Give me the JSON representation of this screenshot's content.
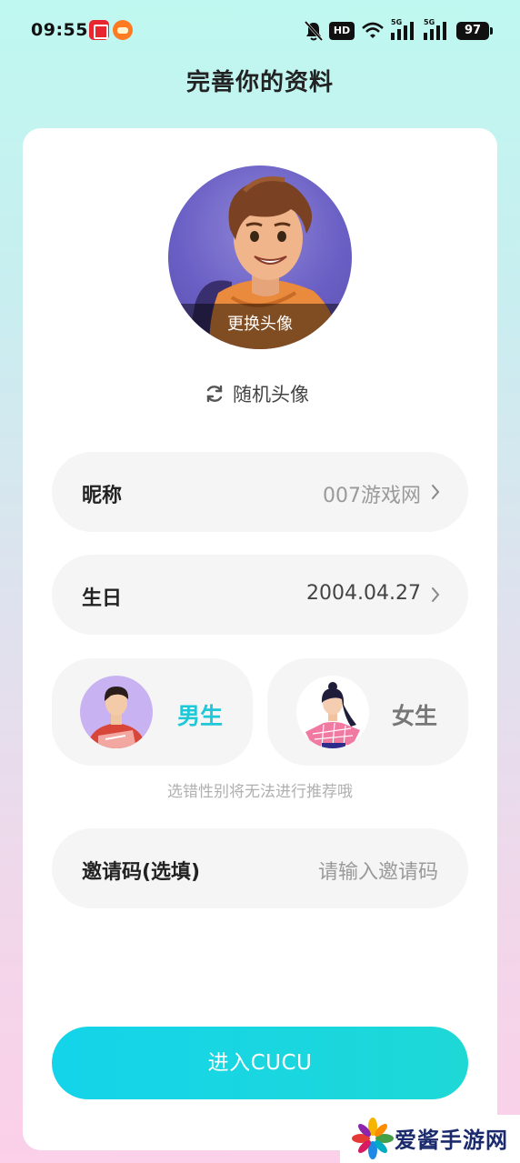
{
  "status_bar": {
    "time": "09:55",
    "network_badge": "HD",
    "signal1_label": "5G",
    "signal2_label": "5G",
    "battery": "97",
    "icons": [
      "taobao-app-icon",
      "food-app-icon",
      "mute-bell-icon",
      "hd-icon",
      "wifi-icon",
      "signal-icon",
      "signal-icon",
      "battery-icon"
    ]
  },
  "header": {
    "title": "完善你的资料"
  },
  "avatar": {
    "change_label": "更换头像",
    "random_label": "随机头像"
  },
  "form": {
    "nickname": {
      "label": "昵称",
      "value": "007游戏网"
    },
    "birthday": {
      "label": "生日",
      "value": "2004.04.27"
    },
    "gender": {
      "male_label": "男生",
      "female_label": "女生",
      "selected": "male",
      "hint": "选错性别将无法进行推荐哦"
    },
    "invite": {
      "label": "邀请码(选填)",
      "placeholder": "请输入邀请码"
    }
  },
  "actions": {
    "enter_label": "进入CUCU"
  },
  "colors": {
    "accent": "#1fc8d8",
    "button_start": "#14d4ea",
    "button_end": "#1ed8d6"
  },
  "watermark": {
    "text": "爱酱手游网"
  }
}
